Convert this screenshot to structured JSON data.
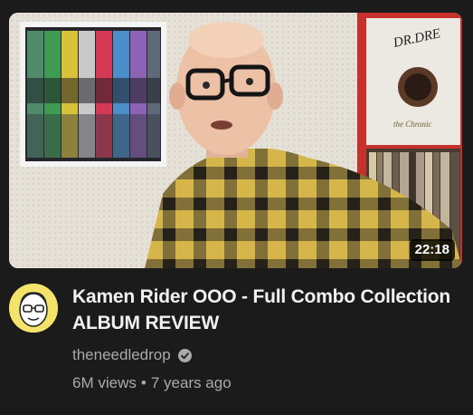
{
  "video": {
    "title": "Kamen Rider OOO - Full Combo Collection ALBUM REVIEW",
    "duration": "22:18",
    "channel": "theneedledrop",
    "views": "6M views",
    "separator": "•",
    "age": "7 years ago"
  },
  "thumbnail": {
    "record_label_text": "DR.DRE",
    "record_subtitle_text": "the Chronic"
  },
  "icons": {
    "verified": "verified-check-icon"
  },
  "colors": {
    "background": "#1b1b1b",
    "title": "#f1f1f1",
    "secondary_text": "#aaaaaa",
    "avatar_bg": "#f3e36b",
    "shirt_yellow": "#d8b84a",
    "shirt_dark": "#3a3526"
  }
}
